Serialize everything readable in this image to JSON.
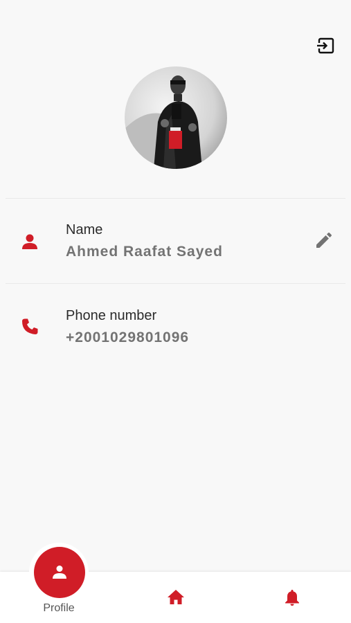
{
  "colors": {
    "accent": "#d01d27",
    "muted": "#737373"
  },
  "header": {
    "logout_icon": "logout-icon"
  },
  "profile": {
    "avatar_icon": "avatar",
    "fields": [
      {
        "label": "Name",
        "value": "Ahmed Raafat Sayed",
        "icon": "person-icon",
        "editable": true
      },
      {
        "label": "Phone number",
        "value": "+2001029801096",
        "icon": "phone-icon",
        "editable": false
      }
    ]
  },
  "bottom_nav": {
    "items": [
      {
        "label": "Profile",
        "icon": "person-icon",
        "active": true
      },
      {
        "label": "",
        "icon": "home-icon",
        "active": false
      },
      {
        "label": "",
        "icon": "bell-icon",
        "active": false
      }
    ]
  }
}
